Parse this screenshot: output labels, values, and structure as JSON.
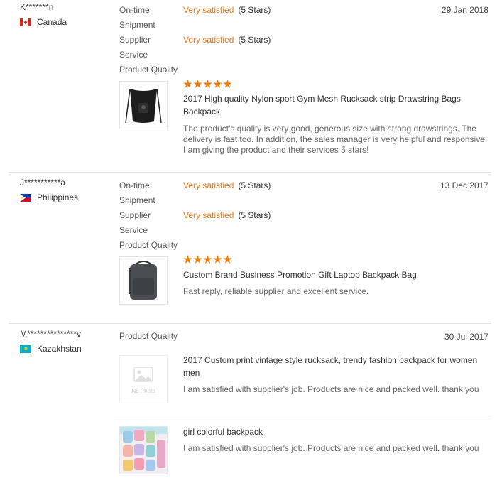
{
  "reviews": [
    {
      "buyer": "K*******n",
      "country": "Canada",
      "date": "29 Jan 2018",
      "ontime_label": "On-time Shipment",
      "ontime_rating": "Very satisfied",
      "ontime_stars": "(5 Stars)",
      "service_label": "Supplier Service",
      "service_rating": "Very satisfied",
      "service_stars": "(5 Stars)",
      "quality_label": "Product Quality",
      "product_stars": 5,
      "product_title": "2017 High quality Nylon sport Gym Mesh Rucksack strip Drawstring Bags Backpack",
      "product_review": "The product's quality is very good, generous size with strong drawstrings. The delivery is fast too. In addition, the sales manager is very helpful and responsive. I am giving the product and their services 5 stars!"
    },
    {
      "buyer": "J***********a",
      "country": "Philippines",
      "date": "13 Dec 2017",
      "ontime_label": "On-time Shipment",
      "ontime_rating": "Very satisfied",
      "ontime_stars": "(5 Stars)",
      "service_label": "Supplier Service",
      "service_rating": "Very satisfied",
      "service_stars": "(5 Stars)",
      "quality_label": "Product Quality",
      "product_stars": 5,
      "product_title": "Custom Brand Business Promotion Gift Laptop Backpack Bag",
      "product_review": "Fast reply, reliable supplier and excellent service."
    },
    {
      "buyer": "M***************v",
      "country": "Kazakhstan",
      "date": "30 Jul 2017",
      "quality_label": "Product Quality",
      "products": [
        {
          "title": "2017 Custom print vintage style rucksack, trendy fashion backpack for women men",
          "review": "I am satisfied with supplier's job. Products are nice and packed well. thank you",
          "thumb_text": "No Photo"
        },
        {
          "title": "girl colorful backpack",
          "review": "I am satisfied with supplier's job. Products are nice and packed well. thank you"
        }
      ]
    }
  ],
  "icons": {
    "flags": [
      "canada-flag-icon",
      "philippines-flag-icon",
      "kazakhstan-flag-icon"
    ],
    "star": "star-icon"
  },
  "colors": {
    "rating_text": "#e67e22",
    "star": "#f07c10"
  }
}
